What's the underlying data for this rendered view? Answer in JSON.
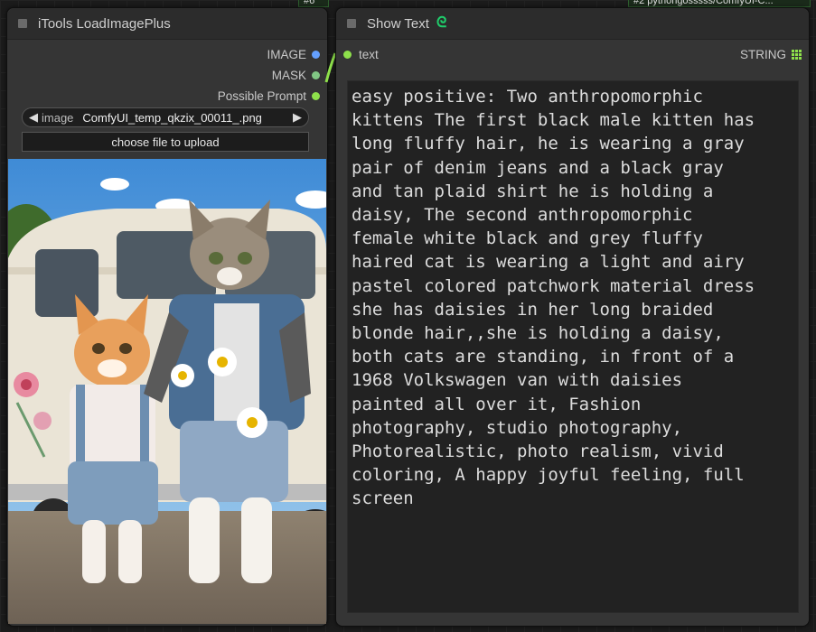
{
  "badges": {
    "left": "#6",
    "right": "#2 pythongosssss/ComfyUI-C..."
  },
  "load_node": {
    "title": "iTools LoadImagePlus",
    "outputs": [
      {
        "label": "IMAGE",
        "color": "#64a0ff"
      },
      {
        "label": "MASK",
        "color": "#81c784"
      },
      {
        "label": "Possible Prompt",
        "color": "#8ee04b"
      }
    ],
    "image_widget": {
      "label": "image",
      "value": "ComfyUI_temp_qkzix_00011_.png"
    },
    "upload_label": "choose file to upload"
  },
  "show_node": {
    "title": "Show Text",
    "title_icon": "python-snake-icon",
    "input_label": "text",
    "output_label": "STRING",
    "text": "easy positive: Two anthropomorphic\nkittens The first black male kitten has\nlong fluffy hair, he is wearing a gray\npair of denim jeans and a black gray\nand tan plaid shirt he is holding a\ndaisy, The second anthropomorphic\nfemale white black and grey fluffy\nhaired cat is wearing a light and airy\npastel colored patchwork material dress\nshe has daisies in her long braided\nblonde hair,,she is holding a daisy,\nboth cats are standing, in front of a\n1968 Volkswagen van with daisies\npainted all over it, Fashion\nphotography, studio photography,\nPhotorealistic, photo realism, vivid\ncoloring, A happy joyful feeling, full\nscreen"
  },
  "colors": {
    "link": "#8ee04b",
    "node_bg": "#353535",
    "title_bg": "#2c2c2c"
  }
}
